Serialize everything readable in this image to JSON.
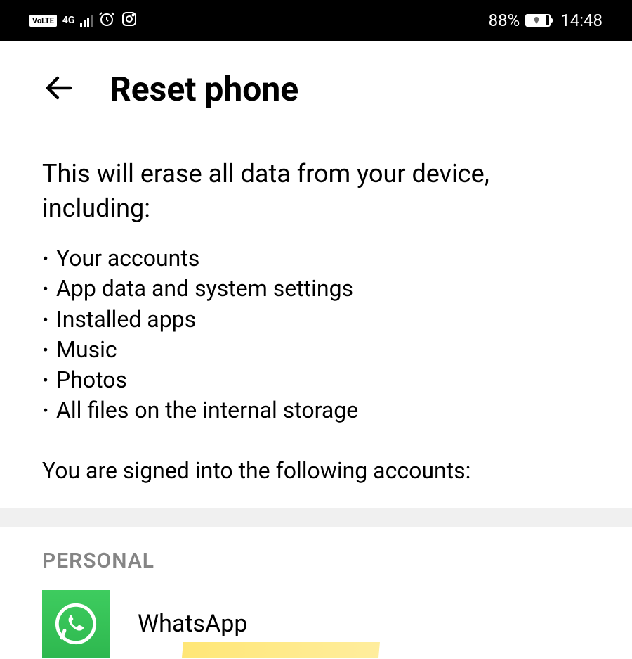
{
  "status_bar": {
    "volte": "VoLTE",
    "network_4g": "4G",
    "battery_percent": "88%",
    "time": "14:48"
  },
  "header": {
    "title": "Reset phone"
  },
  "content": {
    "erase_heading": "This will erase all data from your device, including:",
    "erase_items": [
      "Your accounts",
      "App data and system settings",
      "Installed apps",
      "Music",
      "Photos",
      "All files on the internal storage"
    ],
    "accounts_heading": "You are signed into the following accounts:",
    "section_label": "PERSONAL",
    "accounts": [
      {
        "name": "WhatsApp"
      }
    ]
  }
}
